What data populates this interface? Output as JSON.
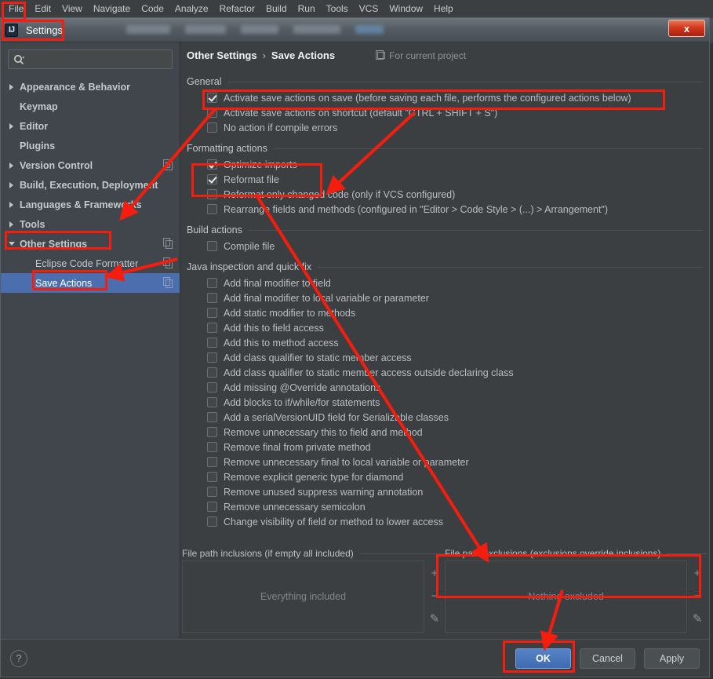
{
  "ide": {
    "menu_items": [
      "File",
      "Edit",
      "View",
      "Navigate",
      "Code",
      "Analyze",
      "Refactor",
      "Build",
      "Run",
      "Tools",
      "VCS",
      "Window",
      "Help"
    ]
  },
  "dialog": {
    "title": "Settings",
    "title_icon": "intellij-idea-icon",
    "close_label": "x"
  },
  "sidebar": {
    "search": {
      "value": "",
      "placeholder": ""
    },
    "items": [
      {
        "label": "Appearance & Behavior",
        "arrow": "right",
        "bold": true,
        "indent": 0,
        "copy": false,
        "selected": false
      },
      {
        "label": "Keymap",
        "arrow": "none",
        "bold": true,
        "indent": 0,
        "copy": false,
        "selected": false
      },
      {
        "label": "Editor",
        "arrow": "right",
        "bold": true,
        "indent": 0,
        "copy": false,
        "selected": false
      },
      {
        "label": "Plugins",
        "arrow": "none",
        "bold": true,
        "indent": 0,
        "copy": false,
        "selected": false
      },
      {
        "label": "Version Control",
        "arrow": "right",
        "bold": true,
        "indent": 0,
        "copy": true,
        "selected": false
      },
      {
        "label": "Build, Execution, Deployment",
        "arrow": "right",
        "bold": true,
        "indent": 0,
        "copy": false,
        "selected": false
      },
      {
        "label": "Languages & Frameworks",
        "arrow": "right",
        "bold": true,
        "indent": 0,
        "copy": false,
        "selected": false
      },
      {
        "label": "Tools",
        "arrow": "right",
        "bold": true,
        "indent": 0,
        "copy": false,
        "selected": false
      },
      {
        "label": "Other Settings",
        "arrow": "down",
        "bold": true,
        "indent": 0,
        "copy": true,
        "selected": false
      },
      {
        "label": "Eclipse Code Formatter",
        "arrow": "none",
        "bold": false,
        "indent": 1,
        "copy": true,
        "selected": false
      },
      {
        "label": "Save Actions",
        "arrow": "none",
        "bold": false,
        "indent": 1,
        "copy": true,
        "selected": true
      }
    ]
  },
  "breadcrumb": {
    "parent": "Other Settings",
    "separator": "›",
    "current": "Save Actions",
    "scope_note": "For current project",
    "scope_icon": "project-scope-icon"
  },
  "sections": {
    "general": {
      "title": "General",
      "options": [
        {
          "label": "Activate save actions on save (before saving each file, performs the configured actions below)",
          "checked": true
        },
        {
          "label": "Activate save actions on shortcut (default \"CTRL + SHIFT + S\")",
          "checked": false
        },
        {
          "label": "No action if compile errors",
          "checked": false
        }
      ]
    },
    "formatting": {
      "title": "Formatting actions",
      "options": [
        {
          "label": "Optimize imports",
          "checked": true
        },
        {
          "label": "Reformat file",
          "checked": true
        },
        {
          "label": "Reformat only changed code (only if VCS configured)",
          "checked": false
        },
        {
          "label": "Rearrange fields and methods (configured in \"Editor > Code Style > (...) > Arrangement\")",
          "checked": false
        }
      ]
    },
    "build": {
      "title": "Build actions",
      "options": [
        {
          "label": "Compile file",
          "checked": false
        }
      ]
    },
    "inspection": {
      "title": "Java inspection and quick fix",
      "options": [
        {
          "label": "Add final modifier to field",
          "checked": false
        },
        {
          "label": "Add final modifier to local variable or parameter",
          "checked": false
        },
        {
          "label": "Add static modifier to methods",
          "checked": false
        },
        {
          "label": "Add this to field access",
          "checked": false
        },
        {
          "label": "Add this to method access",
          "checked": false
        },
        {
          "label": "Add class qualifier to static member access",
          "checked": false
        },
        {
          "label": "Add class qualifier to static member access outside declaring class",
          "checked": false
        },
        {
          "label": "Add missing @Override annotations",
          "checked": false
        },
        {
          "label": "Add blocks to if/while/for statements",
          "checked": false
        },
        {
          "label": "Add a serialVersionUID field for Serializable classes",
          "checked": false
        },
        {
          "label": "Remove unnecessary this to field and method",
          "checked": false
        },
        {
          "label": "Remove final from private method",
          "checked": false
        },
        {
          "label": "Remove unnecessary final to local variable or parameter",
          "checked": false
        },
        {
          "label": "Remove explicit generic type for diamond",
          "checked": false
        },
        {
          "label": "Remove unused suppress warning annotation",
          "checked": false
        },
        {
          "label": "Remove unnecessary semicolon",
          "checked": false
        },
        {
          "label": "Change visibility of field or method to lower access",
          "checked": false
        }
      ]
    }
  },
  "paths": {
    "inclusions": {
      "title": "File path inclusions (if empty all included)",
      "empty_text": "Everything included",
      "add": "+",
      "remove": "−",
      "edit": "✎"
    },
    "exclusions": {
      "title": "File path exclusions (exclusions override inclusions)",
      "empty_text": "Nothing excluded",
      "add": "+",
      "remove": "−",
      "edit": "✎"
    }
  },
  "footer": {
    "help": "?",
    "ok": "OK",
    "cancel": "Cancel",
    "apply": "Apply"
  },
  "colors": {
    "annotation": "#f41d0e",
    "selection": "#4b6eaf",
    "panel_bg": "#3c3f41",
    "sidebar_bg": "#41454c",
    "primary_button": "#4a78c0"
  }
}
